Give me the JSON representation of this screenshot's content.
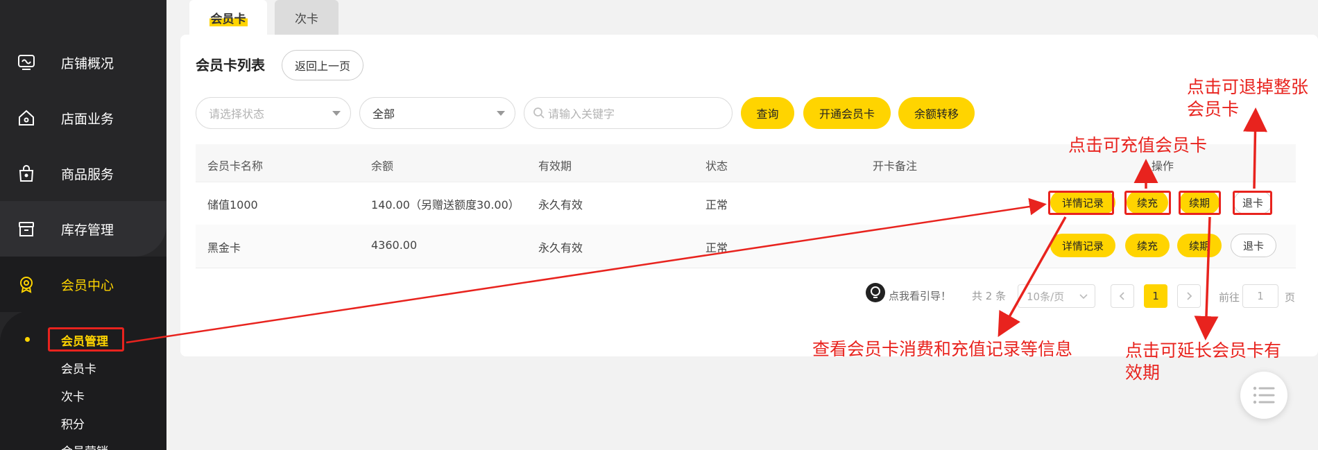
{
  "sidebar": {
    "items": [
      {
        "label": "店铺概况",
        "icon": "monitor-icon"
      },
      {
        "label": "店面业务",
        "icon": "home-icon"
      },
      {
        "label": "商品服务",
        "icon": "bag-icon"
      },
      {
        "label": "库存管理",
        "icon": "box-icon"
      },
      {
        "label": "会员中心",
        "icon": "member-icon"
      }
    ],
    "sub_items": [
      "会员管理",
      "会员卡",
      "次卡",
      "积分",
      "会员营销"
    ]
  },
  "tabs": [
    "会员卡",
    "次卡"
  ],
  "page": {
    "title": "会员卡列表",
    "back_label": "返回上一页"
  },
  "filters": {
    "status_placeholder": "请选择状态",
    "type_value": "全部",
    "search_placeholder": "请输入关键字",
    "query_label": "查询",
    "open_card_label": "开通会员卡",
    "transfer_label": "余额转移"
  },
  "table": {
    "headers": [
      "会员卡名称",
      "余额",
      "有效期",
      "状态",
      "开卡备注",
      "操作"
    ],
    "rows": [
      {
        "name": "储值1000",
        "balance": "140.00（另赠送额度30.00）",
        "validity": "永久有效",
        "status": "正常",
        "note": ""
      },
      {
        "name": "黑金卡",
        "balance": "4360.00",
        "validity": "永久有效",
        "status": "正常",
        "note": ""
      }
    ],
    "actions": [
      "详情记录",
      "续充",
      "续期",
      "退卡"
    ]
  },
  "pagination": {
    "guide": "点我看引导！",
    "total": "共 2 条",
    "page_size": "10条/页",
    "current": "1",
    "goto_prefix": "前往",
    "goto_value": "1",
    "goto_suffix": "页"
  },
  "annotations": {
    "refund": [
      "点击可退掉整张",
      "会员卡"
    ],
    "recharge": "点击可充值会员卡",
    "detail": "查看会员卡消费和充值记录等信息",
    "extend": [
      "点击可延长会员卡有",
      "效期"
    ]
  },
  "colors": {
    "accent": "#ffd400",
    "annotation": "#e8231e",
    "sidebar": "#262628"
  }
}
